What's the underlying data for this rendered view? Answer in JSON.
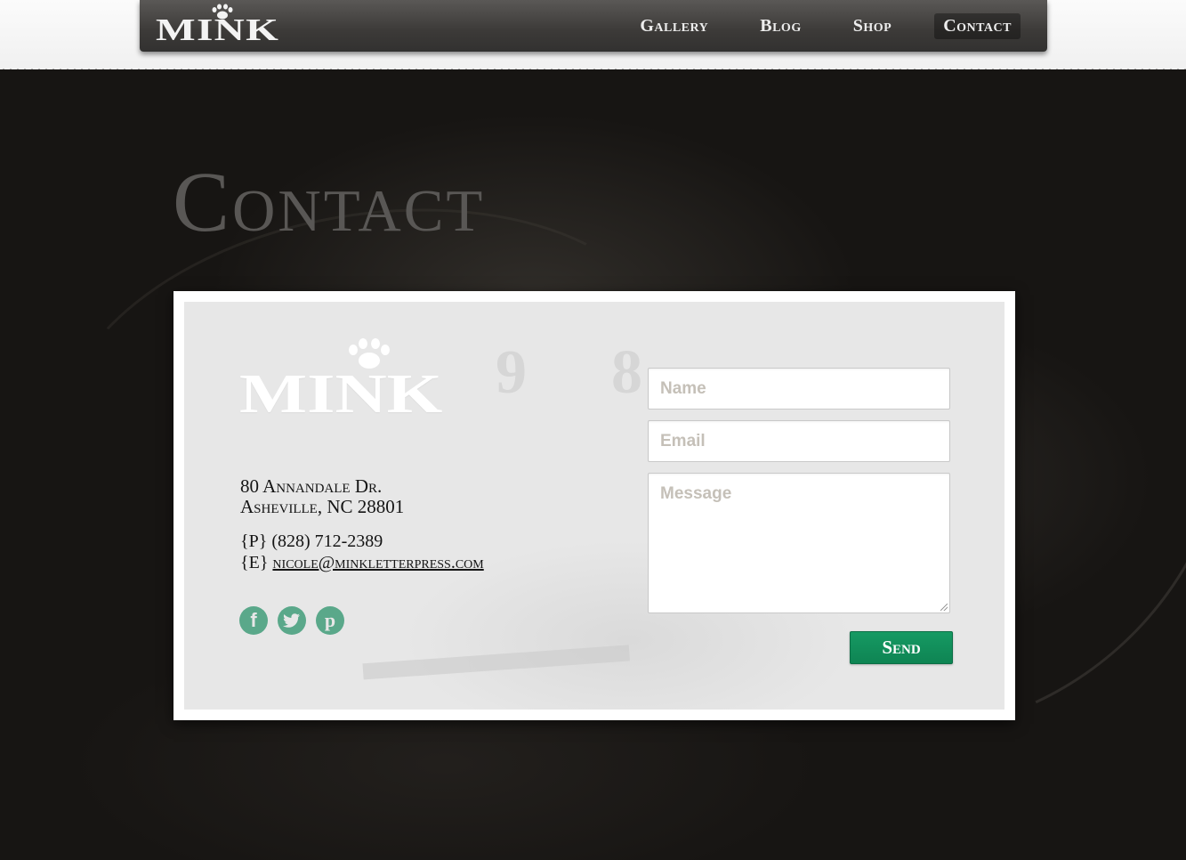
{
  "brand": {
    "logo_text": "MINK"
  },
  "nav": {
    "items": [
      {
        "label": "Gallery"
      },
      {
        "label": "Blog"
      },
      {
        "label": "Shop"
      },
      {
        "label": "Contact",
        "active": true
      }
    ]
  },
  "page": {
    "heading": "Contact"
  },
  "card": {
    "logo_text": "MINK",
    "address_line1": "80 Annandale Dr.",
    "address_line2": "Asheville, NC 28801",
    "phone_prefix": "{P}",
    "phone": "(828) 712-2389",
    "email_prefix": "{E}",
    "email": "nicole@minkletterpress.com",
    "social": [
      {
        "icon": "facebook-icon",
        "glyph": "f"
      },
      {
        "icon": "twitter-icon",
        "glyph": "t"
      },
      {
        "icon": "pinterest-icon",
        "glyph": "p"
      }
    ]
  },
  "form": {
    "name_placeholder": "Name",
    "email_placeholder": "Email",
    "message_placeholder": "Message",
    "send_label": "Send"
  },
  "colors": {
    "accent_green": "#0e8a57",
    "social_green": "#5aa88a",
    "background_dark": "#171513"
  }
}
